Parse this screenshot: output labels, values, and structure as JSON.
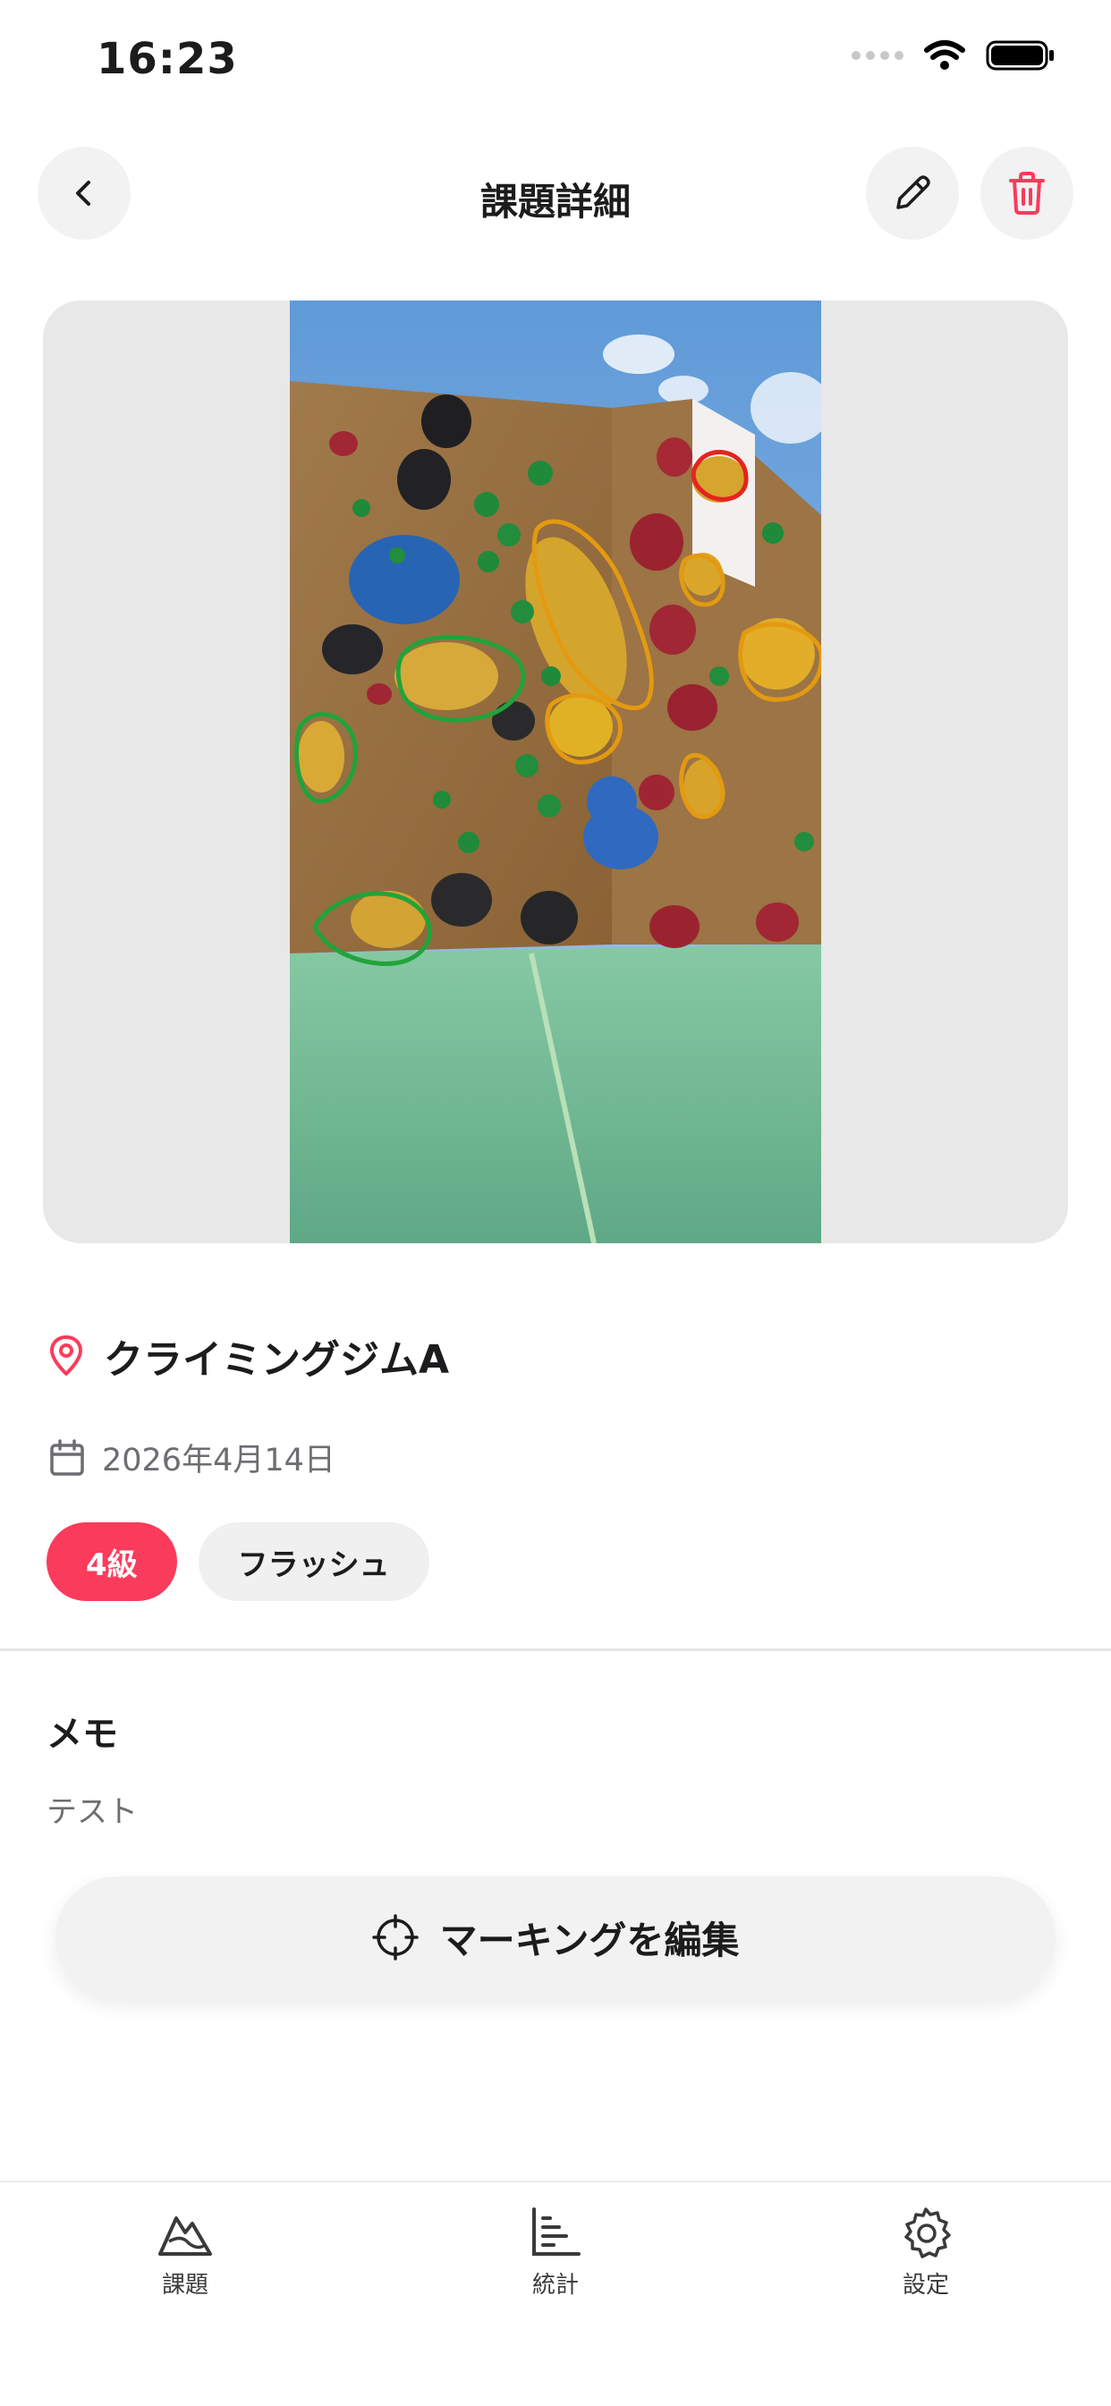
{
  "status_bar": {
    "time": "16:23"
  },
  "nav": {
    "title": "課題詳細",
    "back_icon": "chevron-left-icon",
    "edit_icon": "pencil-icon",
    "delete_icon": "trash-icon"
  },
  "colors": {
    "accent": "#fb3b5c",
    "chip_bg": "#f0f0f0",
    "photo_bg": "#e8e8e8"
  },
  "problem": {
    "location": "クライミングジムA",
    "date": "2026年4月14日",
    "grade": "4級",
    "style": "フラッシュ"
  },
  "memo": {
    "title": "メモ",
    "body": "テスト"
  },
  "actions": {
    "edit_marking": "マーキングを編集"
  },
  "tabs": [
    {
      "label": "課題",
      "icon": "mountain-icon"
    },
    {
      "label": "統計",
      "icon": "bar-chart-icon"
    },
    {
      "label": "設定",
      "icon": "gear-icon"
    }
  ]
}
